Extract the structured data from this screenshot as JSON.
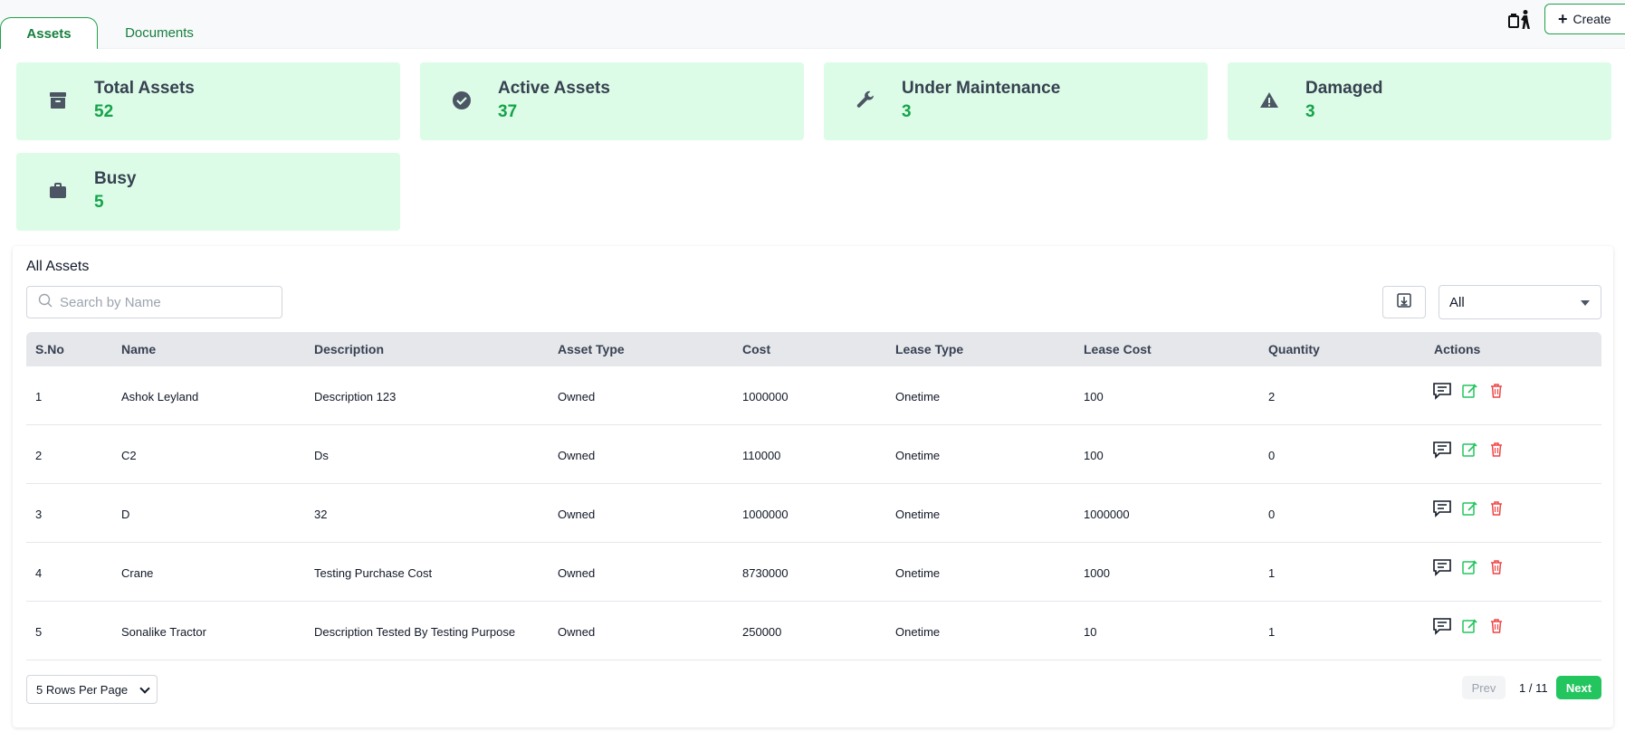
{
  "tabs": [
    {
      "label": "Assets",
      "active": true
    },
    {
      "label": "Documents",
      "active": false
    }
  ],
  "header": {
    "create_label": "Create",
    "action_icon": "person-dispose-icon"
  },
  "stats": [
    {
      "title": "Total Assets",
      "value": "52",
      "icon": "archive-box-icon"
    },
    {
      "title": "Active Assets",
      "value": "37",
      "icon": "check-circle-icon"
    },
    {
      "title": "Under Maintenance",
      "value": "3",
      "icon": "wrench-icon"
    },
    {
      "title": "Damaged",
      "value": "3",
      "icon": "warning-triangle-icon"
    },
    {
      "title": "Busy",
      "value": "5",
      "icon": "briefcase-icon"
    }
  ],
  "panel": {
    "title": "All Assets",
    "search_placeholder": "Search by Name",
    "filter_value": "All"
  },
  "table": {
    "columns": [
      "S.No",
      "Name",
      "Description",
      "Asset Type",
      "Cost",
      "Lease Type",
      "Lease Cost",
      "Quantity",
      "Actions"
    ],
    "rows": [
      {
        "sno": "1",
        "name": "Ashok Leyland",
        "description": "Description 123",
        "asset_type": "Owned",
        "cost": "1000000",
        "lease_type": "Onetime",
        "lease_cost": "100",
        "quantity": "2"
      },
      {
        "sno": "2",
        "name": "C2",
        "description": "Ds",
        "asset_type": "Owned",
        "cost": "110000",
        "lease_type": "Onetime",
        "lease_cost": "100",
        "quantity": "0"
      },
      {
        "sno": "3",
        "name": "D",
        "description": "32",
        "asset_type": "Owned",
        "cost": "1000000",
        "lease_type": "Onetime",
        "lease_cost": "1000000",
        "quantity": "0"
      },
      {
        "sno": "4",
        "name": "Crane",
        "description": "Testing Purchase Cost",
        "asset_type": "Owned",
        "cost": "8730000",
        "lease_type": "Onetime",
        "lease_cost": "1000",
        "quantity": "1"
      },
      {
        "sno": "5",
        "name": "Sonalike Tractor",
        "description": "Description Tested By Testing Purpose",
        "asset_type": "Owned",
        "cost": "250000",
        "lease_type": "Onetime",
        "lease_cost": "10",
        "quantity": "1"
      }
    ]
  },
  "pagination": {
    "rows_per_page": "5 Rows Per Page",
    "prev": "Prev",
    "page_indicator": "1 / 11",
    "next": "Next"
  },
  "colors": {
    "accent": "#22c55e",
    "card_bg": "#dcfce7",
    "value_green": "#16a34a",
    "delete_red": "#ef4444"
  }
}
